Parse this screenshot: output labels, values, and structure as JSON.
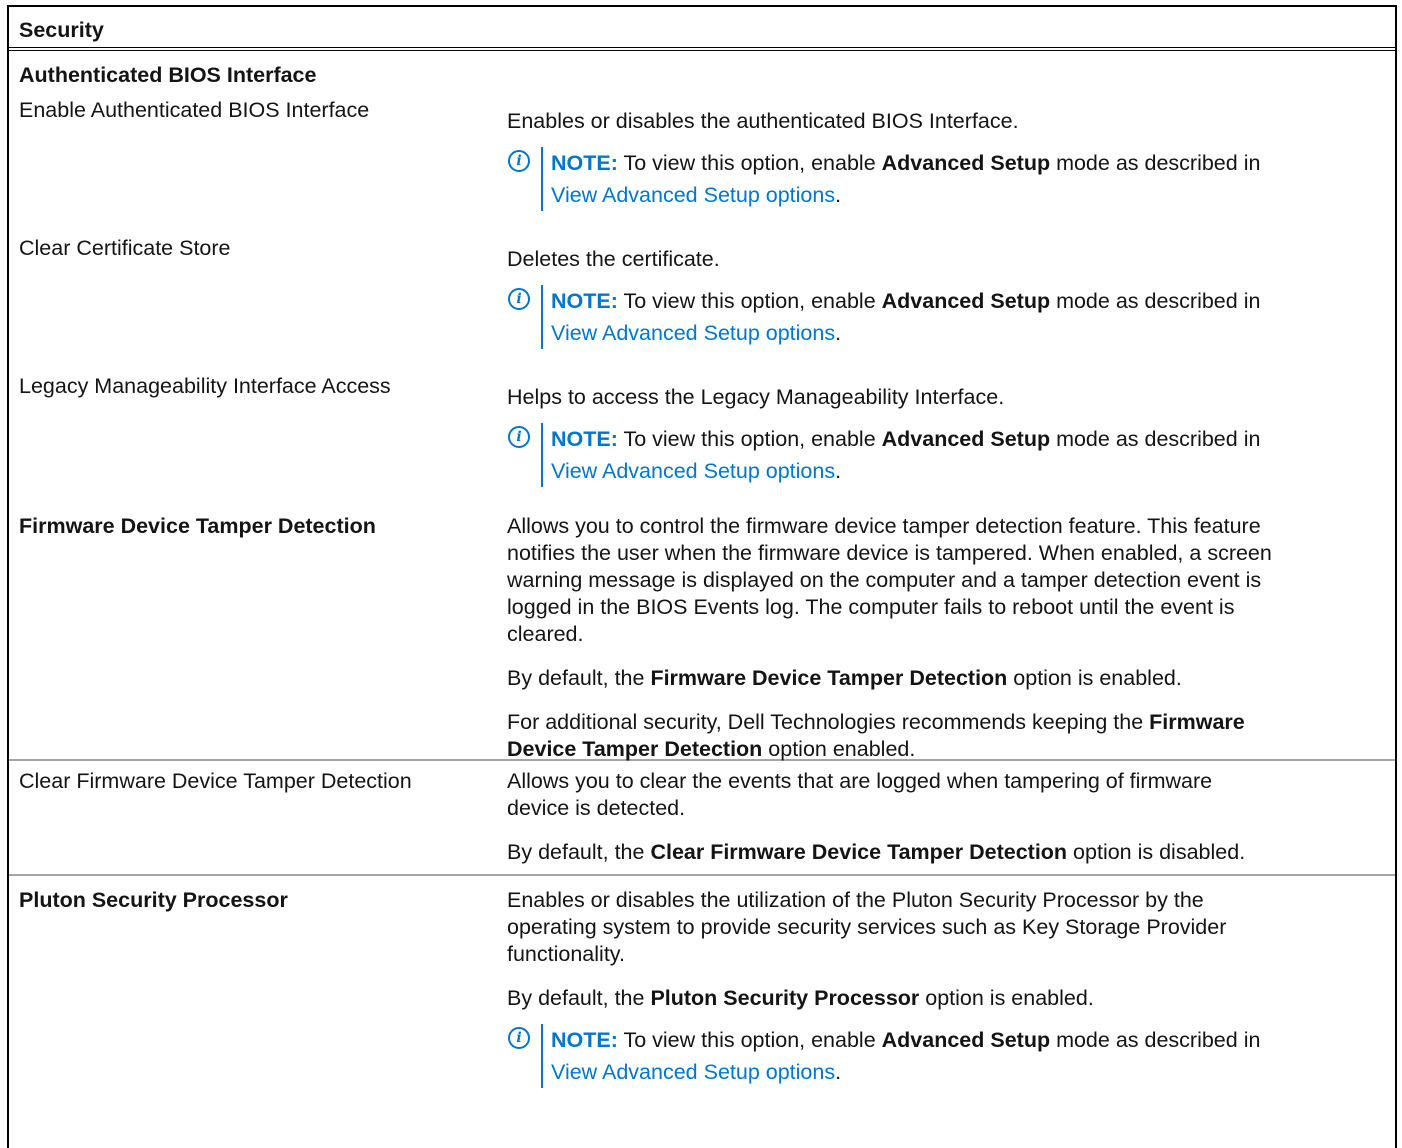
{
  "header": {
    "title": "Security"
  },
  "section": {
    "title": "Authenticated BIOS Interface"
  },
  "note": {
    "label": "NOTE:",
    "text_before": " To view this option, enable ",
    "bold": "Advanced Setup",
    "text_after": " mode as described in",
    "link": "View Advanced Setup options",
    "end": "."
  },
  "rows": [
    {
      "name": "Enable Authenticated BIOS Interface",
      "desc": "Enables or disables the authenticated BIOS Interface."
    },
    {
      "name": "Clear Certificate Store",
      "desc": "Deletes the certificate."
    },
    {
      "name": "Legacy Manageability Interface Access",
      "desc": "Helps to access the Legacy Manageability Interface."
    },
    {
      "name": "Firmware Device Tamper Detection",
      "desc_lines": [
        "Allows you to control the firmware device tamper detection feature. This feature",
        "notifies the user when the firmware device is tampered. When enabled, a screen",
        "warning message is displayed on the computer and a tamper detection event is",
        "logged in the BIOS Events log. The computer fails to reboot until the event is",
        "cleared."
      ],
      "default_before": "By default, the ",
      "default_bold": "Firmware Device Tamper Detection",
      "default_after": " option is enabled.",
      "rec_before": "For additional security, Dell Technologies recommends keeping the ",
      "rec_bold1": "Firmware",
      "rec_bold2": "Device Tamper Detection",
      "rec_after": " option enabled."
    },
    {
      "name": "Clear Firmware Device Tamper Detection",
      "desc_lines": [
        "Allows you to clear the events that are logged when tampering of firmware",
        "device is detected."
      ],
      "default_before": "By default, the ",
      "default_bold": "Clear Firmware Device Tamper Detection",
      "default_after": " option is disabled."
    },
    {
      "name": "Pluton Security Processor",
      "desc_lines": [
        "Enables or disables the utilization of the Pluton Security Processor by the",
        "operating system to provide security services such as Key Storage Provider",
        "functionality."
      ],
      "default_before": "By default, the ",
      "default_bold": "Pluton Security Processor",
      "default_after": " option is enabled."
    }
  ]
}
